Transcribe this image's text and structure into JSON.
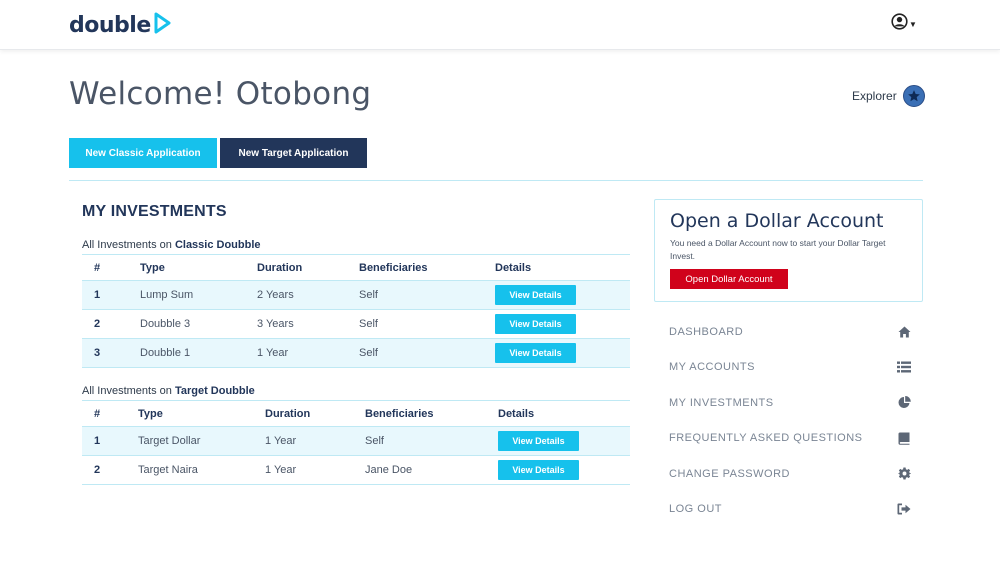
{
  "header": {
    "logo_text": "double",
    "logo_icon": "play-icon",
    "user_icon": "user-circle-icon",
    "user_caret_icon": "caret-down-icon"
  },
  "welcome": {
    "title": "Welcome! Otobong",
    "explorer_label": "Explorer",
    "explorer_icon": "star-icon"
  },
  "actions": {
    "new_classic": "New Classic Application",
    "new_target": "New Target Application"
  },
  "investments": {
    "section_title": "MY INVESTMENTS",
    "caption_prefix": "All Investments on",
    "columns": [
      "#",
      "Type",
      "Duration",
      "Beneficiaries",
      "Details"
    ],
    "classic": {
      "name": "Classic Doubble",
      "rows": [
        {
          "num": "1",
          "type": "Lump Sum",
          "duration": "2 Years",
          "beneficiaries": "Self",
          "details": "View Details"
        },
        {
          "num": "2",
          "type": "Doubble 3",
          "duration": "3 Years",
          "beneficiaries": "Self",
          "details": "View Details"
        },
        {
          "num": "3",
          "type": "Doubble 1",
          "duration": "1 Year",
          "beneficiaries": "Self",
          "details": "View Details"
        }
      ]
    },
    "target": {
      "name": "Target Doubble",
      "rows": [
        {
          "num": "1",
          "type": "Target Dollar",
          "duration": "1 Year",
          "beneficiaries": "Self",
          "details": "View Details"
        },
        {
          "num": "2",
          "type": "Target Naira",
          "duration": "1 Year",
          "beneficiaries": "Jane Doe",
          "details": "View Details"
        }
      ]
    }
  },
  "dollar_card": {
    "title": "Open a Dollar Account",
    "text": "You need a Dollar Account now to start your Dollar Target Invest.",
    "button": "Open Dollar Account"
  },
  "side_nav": [
    {
      "label": "DASHBOARD",
      "icon": "home-icon"
    },
    {
      "label": "MY ACCOUNTS",
      "icon": "list-icon"
    },
    {
      "label": "MY INVESTMENTS",
      "icon": "pie-chart-icon"
    },
    {
      "label": "FREQUENTLY ASKED QUESTIONS",
      "icon": "book-icon"
    },
    {
      "label": "CHANGE PASSWORD",
      "icon": "gear-icon"
    },
    {
      "label": "LOG OUT",
      "icon": "sign-out-icon"
    }
  ],
  "colors": {
    "brand_navy": "#22365a",
    "accent_cyan": "#16c1ec",
    "danger_red": "#d0021b",
    "row_shade": "#e8f8fd"
  }
}
